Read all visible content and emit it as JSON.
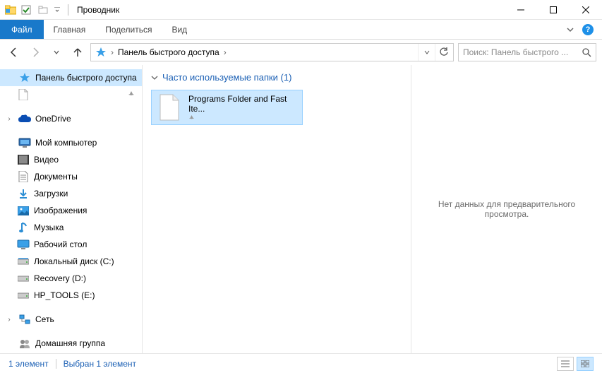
{
  "titlebar": {
    "title": "Проводник"
  },
  "ribbon": {
    "file": "Файл",
    "tabs": [
      "Главная",
      "Поделиться",
      "Вид"
    ]
  },
  "address": {
    "segment": "Панель быстрого доступа",
    "search_placeholder": "Поиск: Панель быстрого ..."
  },
  "sidebar": {
    "quick_access": "Панель быстрого доступа",
    "item_blank": "",
    "onedrive": "OneDrive",
    "my_computer": "Мой компьютер",
    "children": [
      "Видео",
      "Документы",
      "Загрузки",
      "Изображения",
      "Музыка",
      "Рабочий стол",
      "Локальный диск (C:)",
      "Recovery (D:)",
      "HP_TOOLS (E:)"
    ],
    "network": "Сеть",
    "homegroup": "Домашняя группа"
  },
  "content": {
    "group_header": "Часто используемые папки (1)",
    "tile_label": "Programs Folder and Fast Ite..."
  },
  "preview": {
    "empty": "Нет данных для предварительного просмотра."
  },
  "status": {
    "count": "1 элемент",
    "selected": "Выбран 1 элемент"
  }
}
